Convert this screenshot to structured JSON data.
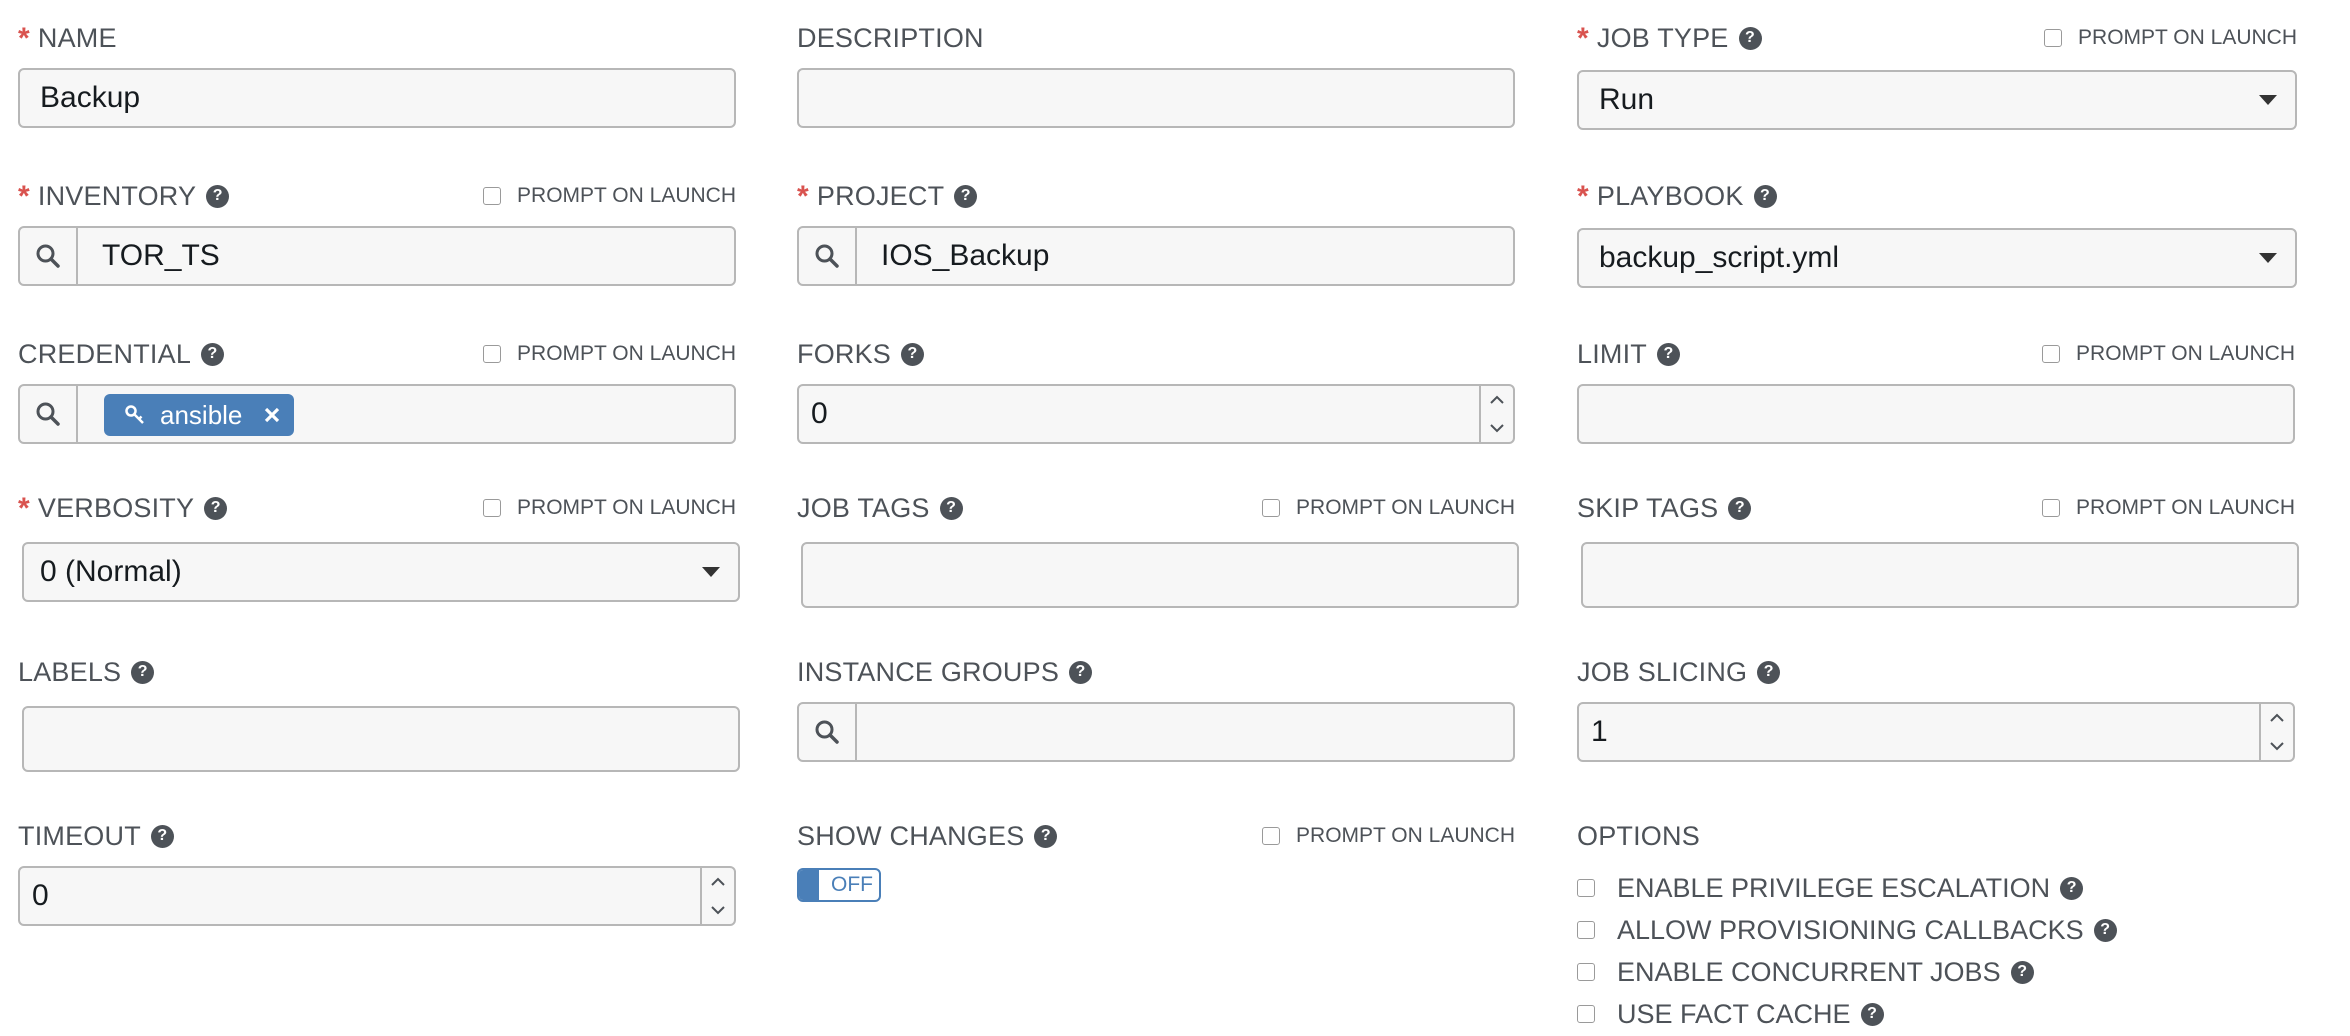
{
  "prompt_on_launch": "PROMPT ON LAUNCH",
  "fields": {
    "name": {
      "label": "NAME",
      "value": "Backup"
    },
    "description": {
      "label": "DESCRIPTION",
      "value": ""
    },
    "job_type": {
      "label": "JOB TYPE",
      "value": "Run"
    },
    "inventory": {
      "label": "INVENTORY",
      "value": "TOR_TS"
    },
    "project": {
      "label": "PROJECT",
      "value": "IOS_Backup"
    },
    "playbook": {
      "label": "PLAYBOOK",
      "value": "backup_script.yml"
    },
    "credential": {
      "label": "CREDENTIAL",
      "tag": "ansible",
      "tag_icon": "key-icon"
    },
    "forks": {
      "label": "FORKS",
      "value": "0"
    },
    "limit": {
      "label": "LIMIT",
      "value": ""
    },
    "verbosity": {
      "label": "VERBOSITY",
      "value": "0 (Normal)"
    },
    "job_tags": {
      "label": "JOB TAGS",
      "value": ""
    },
    "skip_tags": {
      "label": "SKIP TAGS",
      "value": ""
    },
    "labels": {
      "label": "LABELS",
      "value": ""
    },
    "instance_groups": {
      "label": "INSTANCE GROUPS",
      "value": ""
    },
    "job_slicing": {
      "label": "JOB SLICING",
      "value": "1"
    },
    "timeout": {
      "label": "TIMEOUT",
      "value": "0"
    },
    "show_changes": {
      "label": "SHOW CHANGES",
      "toggle": "OFF"
    }
  },
  "options": {
    "label": "OPTIONS",
    "items": [
      {
        "label": "ENABLE PRIVILEGE ESCALATION",
        "checked": false
      },
      {
        "label": "ALLOW PROVISIONING CALLBACKS",
        "checked": false
      },
      {
        "label": "ENABLE CONCURRENT JOBS",
        "checked": false
      },
      {
        "label": "USE FACT CACHE",
        "checked": false
      }
    ]
  },
  "colors": {
    "required": "#d9534f",
    "accent": "#4a7fb8",
    "label_text": "#4d5258",
    "input_border": "#b7b7b7",
    "input_bg": "#f7f7f7"
  }
}
